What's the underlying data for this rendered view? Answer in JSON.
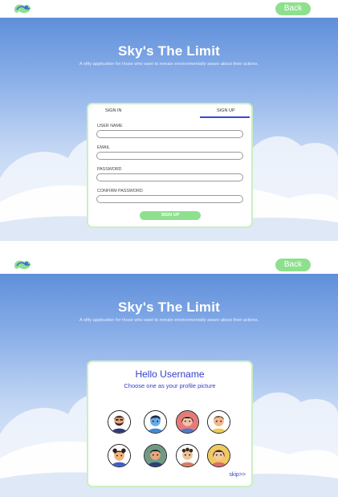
{
  "screens": {
    "signup": {
      "back_label": "Back",
      "title": "Sky's The Limit",
      "subtitle": "A nifty application for those who want to remain environmentally aware about their actions.",
      "tabs": {
        "signin": "SIGN IN",
        "signup": "SIGN UP"
      },
      "fields": {
        "username": {
          "label": "USER NAME",
          "value": ""
        },
        "email": {
          "label": "EMAIL",
          "value": ""
        },
        "password": {
          "label": "PASSWORD",
          "value": ""
        },
        "confirm": {
          "label": "CONFIRM PASSWORD",
          "value": ""
        }
      },
      "submit_label": "SIGN UP"
    },
    "avatar": {
      "back_label": "Back",
      "title": "Sky's The Limit",
      "subtitle": "A nifty application for those who want to remain environmentally aware about their actions.",
      "greeting": "Hello Username",
      "prompt": "Choose one as your profile picture",
      "avatars": [
        {
          "icon": "avatar-bearded-man-icon",
          "bg": "#ffffff"
        },
        {
          "icon": "avatar-blue-man-icon",
          "bg": "#ffffff"
        },
        {
          "icon": "avatar-pink-woman-icon",
          "bg": "#e67a7a"
        },
        {
          "icon": "avatar-man-yellow-shirt-icon",
          "bg": "#ffffff"
        },
        {
          "icon": "avatar-woman-buns-icon",
          "bg": "#ffffff"
        },
        {
          "icon": "avatar-green-man-icon",
          "bg": "#6f9a86"
        },
        {
          "icon": "avatar-curly-man-icon",
          "bg": "#ffffff"
        },
        {
          "icon": "avatar-yellow-woman-icon",
          "bg": "#f0c95f"
        }
      ],
      "skip_label": "skip>>"
    }
  },
  "colors": {
    "accent_green": "#8ee08e",
    "accent_blue": "#3340c8",
    "sky_top": "#5f8fda",
    "card_border": "#c9efc2"
  }
}
